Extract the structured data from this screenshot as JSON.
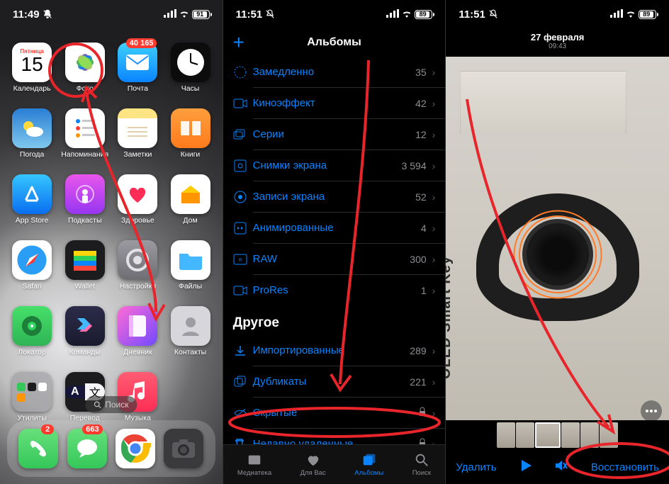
{
  "s1": {
    "status": {
      "time": "11:49",
      "battery": "91"
    },
    "calendar": {
      "day": "Пятница",
      "date": "15",
      "label": "Календарь"
    },
    "apps": {
      "photos": "Фото",
      "mail": {
        "label": "Почта",
        "badge": "40 165"
      },
      "clock": "Часы",
      "weather": "Погода",
      "reminders": "Напоминания",
      "notes": "Заметки",
      "books": "Книги",
      "appstore": "App Store",
      "podcasts": "Подкасты",
      "health": "Здоровье",
      "home": "Дом",
      "safari": "Safari",
      "wallet": "Wallet",
      "settings": "Настройки",
      "files": "Файлы",
      "findmy": "Локатор",
      "shortcuts": "Команды",
      "journal": "Дневник",
      "contacts": "Контакты",
      "utilities": "Утилиты",
      "translate": "Перевод",
      "music": "Музыка"
    },
    "dock": {
      "phone_badge": "2",
      "messages_badge": "663"
    },
    "search": "Поиск"
  },
  "s2": {
    "status": {
      "time": "11:51",
      "battery": "89"
    },
    "title": "Альбомы",
    "rows": [
      {
        "name": "Замедленно",
        "count": "35"
      },
      {
        "name": "Киноэффект",
        "count": "42"
      },
      {
        "name": "Серии",
        "count": "12"
      },
      {
        "name": "Снимки экрана",
        "count": "3 594"
      },
      {
        "name": "Записи экрана",
        "count": "52"
      },
      {
        "name": "Анимированные",
        "count": "4"
      },
      {
        "name": "RAW",
        "count": "300"
      },
      {
        "name": "ProRes",
        "count": "1"
      }
    ],
    "section": "Другое",
    "rows2": [
      {
        "name": "Импортированные",
        "count": "289"
      },
      {
        "name": "Дубликаты",
        "count": "221"
      },
      {
        "name": "Скрытые",
        "lock": true
      },
      {
        "name": "Недавно удаленные",
        "lock": true
      }
    ],
    "tabs": {
      "library": "Медиатека",
      "foryou": "Для Вас",
      "albums": "Альбомы",
      "search": "Поиск"
    }
  },
  "s3": {
    "status": {
      "time": "11:51",
      "battery": "89"
    },
    "date": "27 февраля",
    "timecap": "09:43",
    "photo_text": "OLED Smart Key",
    "bottom": {
      "delete": "Удалить",
      "restore": "Восстановить"
    }
  }
}
